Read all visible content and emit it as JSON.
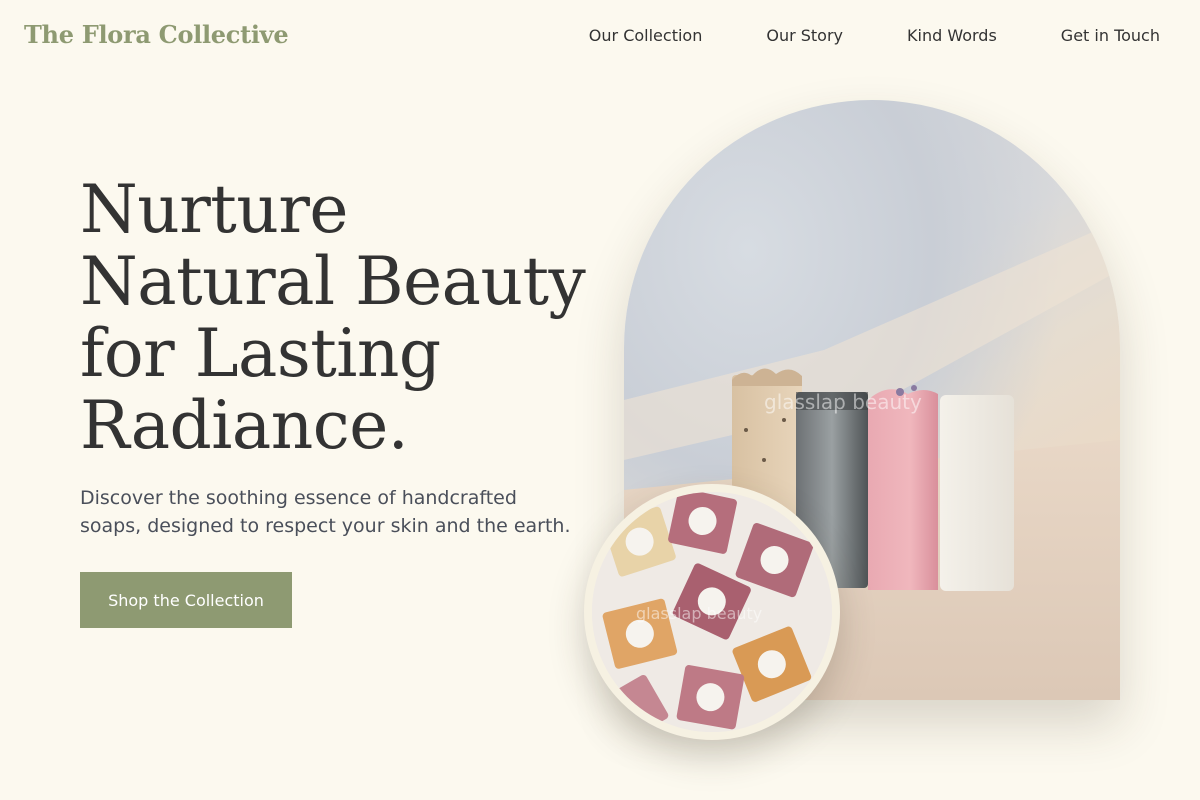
{
  "brand": {
    "name": "The Flora Collective"
  },
  "nav": {
    "items": [
      {
        "label": "Our Collection"
      },
      {
        "label": "Our Story"
      },
      {
        "label": "Kind Words"
      },
      {
        "label": "Get in Touch"
      }
    ]
  },
  "hero": {
    "title_lines": [
      "Nurture",
      "Natural Beauty",
      "for Lasting",
      "Radiance."
    ],
    "subtitle": "Discover the soothing essence of handcrafted soaps, designed to respect your skin and the earth.",
    "cta_label": "Shop the Collection"
  },
  "images": {
    "main_watermark": "glasslap beauty",
    "small_watermark": "glasslap beauty"
  },
  "colors": {
    "background": "#fcf9ef",
    "accent": "#8e9a72",
    "text": "#333333",
    "subtext": "#4a4f5a"
  }
}
